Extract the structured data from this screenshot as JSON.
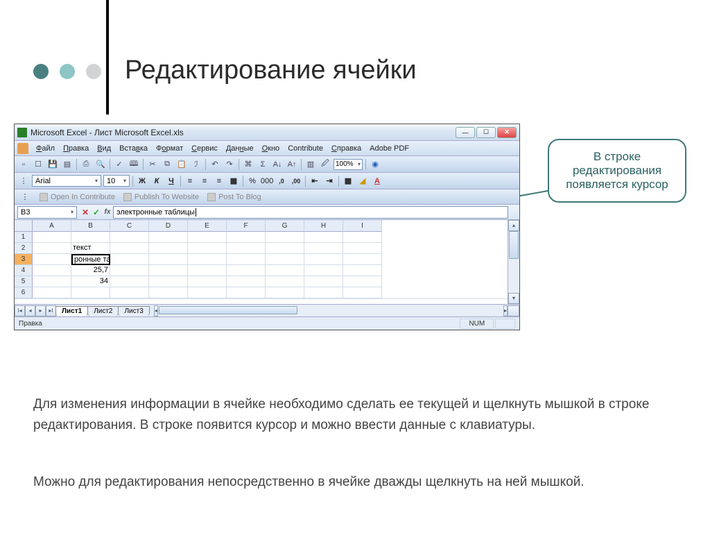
{
  "slide": {
    "title": "Редактирование ячейки",
    "callout": "В строке редактирования появляется курсор",
    "para1": "Для изменения информации в ячейке необходимо сделать ее текущей и щелкнуть мышкой в строке редактирования.  В строке появится курсор и можно ввести данные с клавиатуры.",
    "para2": "Можно для редактирования непосредственно в ячейке дважды щелкнуть на ней мышкой."
  },
  "window": {
    "title": "Microsoft Excel - Лист Microsoft Excel.xls",
    "menus": [
      "Файл",
      "Правка",
      "Вид",
      "Вставка",
      "Формат",
      "Сервис",
      "Данные",
      "Окно",
      "Contribute",
      "Справка",
      "Adobe PDF"
    ],
    "menu_underline_index": [
      0,
      0,
      0,
      4,
      1,
      0,
      3,
      0,
      -1,
      0,
      -1
    ],
    "zoom": "100%",
    "font_name": "Arial",
    "font_size": "10",
    "contribute": {
      "open": "Open In Contribute",
      "publish": "Publish To Website",
      "post": "Post To Blog"
    },
    "name_box": "B3",
    "formula_text": "электронные таблицы",
    "columns": [
      "A",
      "B",
      "C",
      "D",
      "E",
      "F",
      "G",
      "H",
      "I"
    ],
    "rows": [
      "1",
      "2",
      "3",
      "4",
      "5",
      "6"
    ],
    "cells": {
      "b2": "текст",
      "b3": "ронные та",
      "b4": "25,7",
      "b5": "34"
    },
    "sheet_tabs": [
      "Лист1",
      "Лист2",
      "Лист3"
    ],
    "status_left": "Правка",
    "status_num": "NUM"
  }
}
